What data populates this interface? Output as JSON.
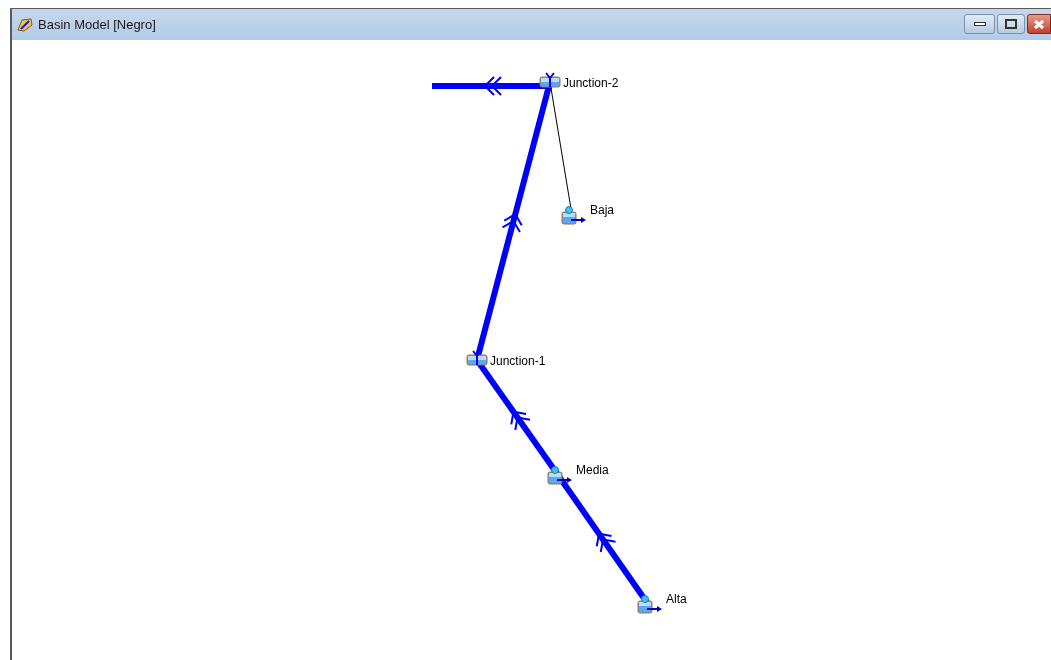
{
  "window": {
    "title": "Basin Model [Negro]"
  },
  "elements": [
    {
      "kind": "junction",
      "label": "Junction-2"
    },
    {
      "kind": "subbasin",
      "label": "Baja"
    },
    {
      "kind": "junction",
      "label": "Junction-1"
    },
    {
      "kind": "subbasin",
      "label": "Media"
    },
    {
      "kind": "subbasin",
      "label": "Alta"
    }
  ]
}
